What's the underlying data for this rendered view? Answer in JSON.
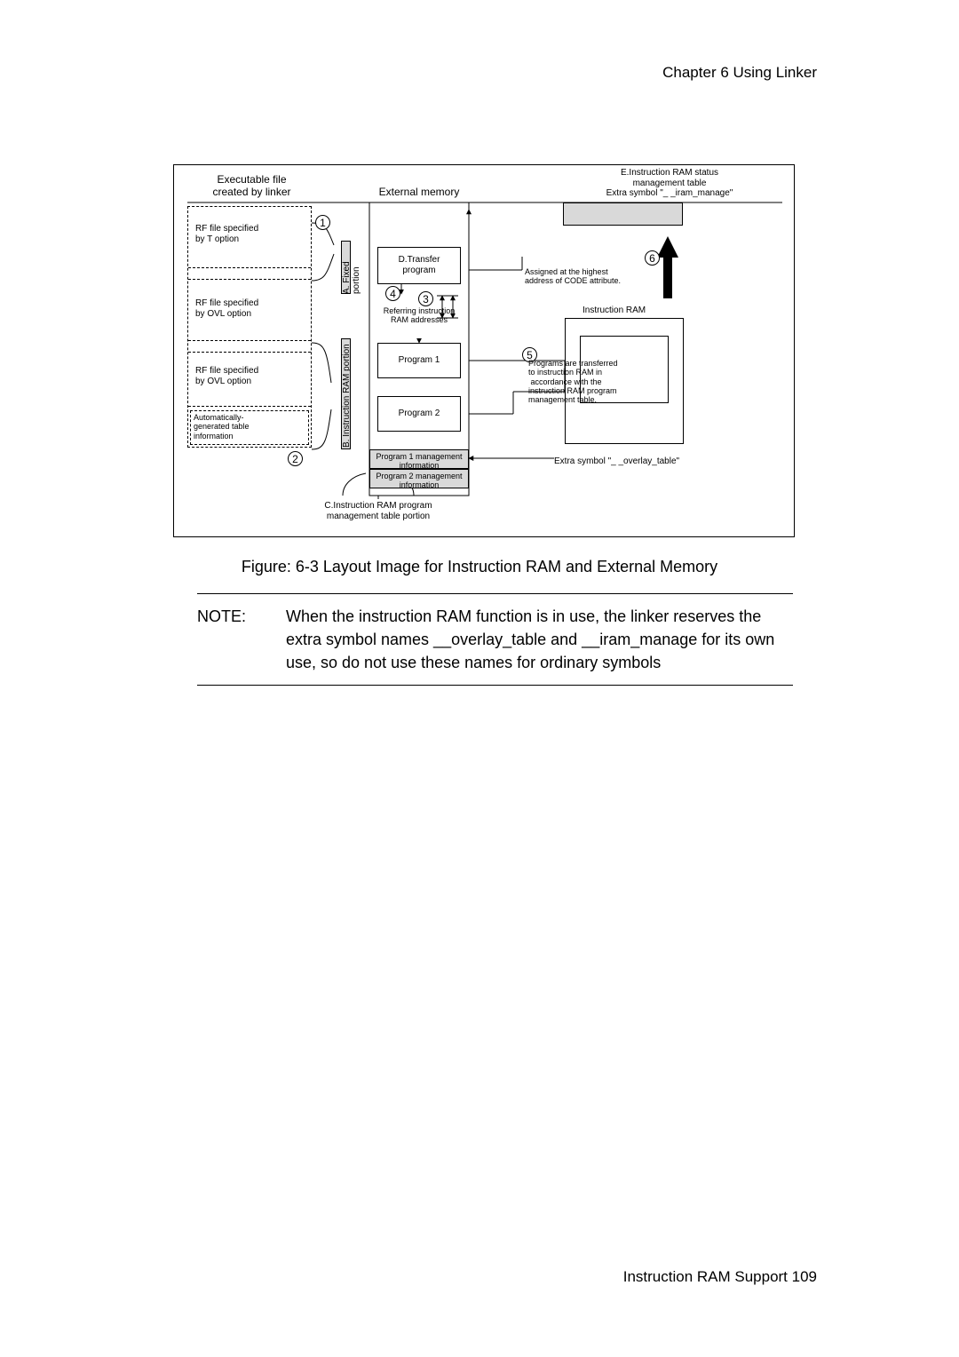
{
  "header": "Chapter  6   Using Linker",
  "caption": "Figure: 6-3  Layout Image for Instruction RAM and External Memory",
  "note_label": "NOTE:",
  "note_body": "When the instruction RAM function is in use, the linker reserves the extra symbol names __overlay_table and __iram_manage for its own use, so do not use these names for ordinary symbols",
  "footer": "Instruction RAM Support  109",
  "fig": {
    "col1_title": "Executable file\ncreated by linker",
    "col2_title": "External memory",
    "right_title": "E.Instruction RAM status\nmanagement table\nExtra symbol \"_ _iram_manage\"",
    "rf_t": "RF file specified\nby T option",
    "rf_ovl1": "RF file specified\nby OVL option",
    "rf_ovl2": "RF file specified\nby OVL option",
    "auto_tbl": "Automatically-\ngenerated table\ninformation",
    "strip_a": "A. Fixed portion",
    "strip_b": "B. Instruction RAM portion",
    "d_transfer": "D.Transfer\nprogram",
    "ref_inst": "Referring instruction\nRAM addresses",
    "prog1": "Program 1",
    "prog2": "Program 2",
    "mgmt1": "Program 1 management\ninformation",
    "mgmt2": "Program 2 management\ninformation",
    "c_label": "C.Instruction RAM program\nmanagement table portion",
    "assigned_note": "Assigned at the highest\naddress of CODE attribute.",
    "inst_ram": "Instruction RAM",
    "overlay_sym": "Extra symbol \"_ _overlay_table\"",
    "transfer_note": "Programs are transferred\nto instruction RAM in\n accordance with the\ninstruction RAM program\nmanagement table.",
    "circled": {
      "1": "1",
      "2": "2",
      "3": "3",
      "4": "4",
      "5": "5",
      "6": "6"
    }
  }
}
